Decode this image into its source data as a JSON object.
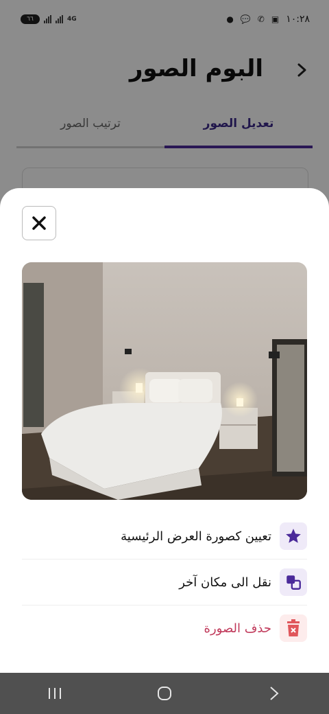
{
  "status": {
    "time": "١٠:٢٨",
    "battery": "٦٦",
    "network": "4G"
  },
  "header": {
    "title": "البوم الصور",
    "back_icon": "chevron-left-icon"
  },
  "tabs": [
    {
      "label": "ترتيب الصور",
      "active": false
    },
    {
      "label": "تعديل الصور",
      "active": true
    }
  ],
  "sheet": {
    "close_icon": "close-icon",
    "photo": "bedroom-photo",
    "menu": [
      {
        "label": "تعيين كصورة العرض الرئيسية",
        "icon": "star-icon",
        "icon_color": "#4b2a9a"
      },
      {
        "label": "نقل الى مكان آخر",
        "icon": "move-icon",
        "icon_color": "#4b2a9a"
      },
      {
        "label": "حذف الصورة",
        "icon": "trash-icon",
        "icon_color": "#e0565b"
      }
    ]
  },
  "colors": {
    "accent": "#4b2a9a",
    "danger": "#c0395a"
  }
}
